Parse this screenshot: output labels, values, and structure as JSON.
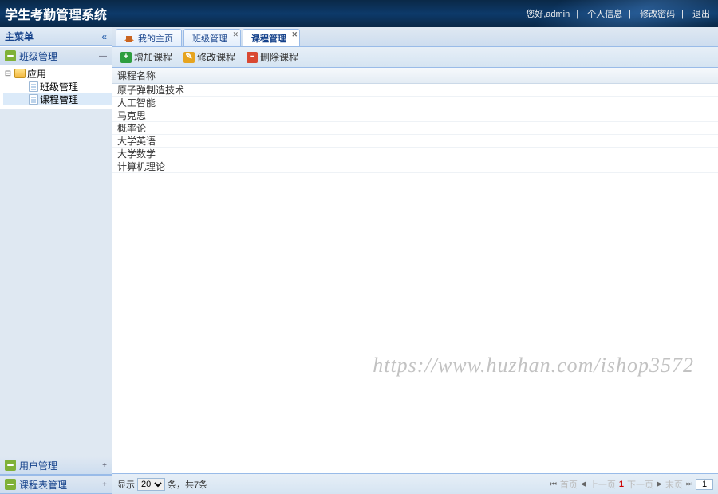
{
  "header": {
    "title": "学生考勤管理系统",
    "greeting": "您好,admin",
    "links": [
      "个人信息",
      "修改密码",
      "退出"
    ]
  },
  "sidebar": {
    "title": "主菜单",
    "panels": [
      {
        "label": "班级管理"
      },
      {
        "label": "用户管理"
      },
      {
        "label": "课程表管理"
      }
    ],
    "tree": {
      "root": {
        "label": "应用"
      },
      "children": [
        {
          "label": "班级管理"
        },
        {
          "label": "课程管理",
          "selected": true
        }
      ]
    }
  },
  "tabs": [
    {
      "label": "我的主页",
      "home": true
    },
    {
      "label": "班级管理",
      "closable": true
    },
    {
      "label": "课程管理",
      "closable": true,
      "active": true
    }
  ],
  "toolbar": {
    "add_label": "增加课程",
    "edit_label": "修改课程",
    "del_label": "删除课程"
  },
  "grid": {
    "header": "课程名称",
    "rows": [
      "原子弹制造技术",
      "人工智能",
      "马克思",
      "概率论",
      "大学英语",
      "大学数学",
      "计算机理论"
    ]
  },
  "status": {
    "show_label": "显示",
    "page_size": "20",
    "unit_label": "条，共7条"
  },
  "pager": {
    "first": "首页",
    "prev": "上一页",
    "current": "1",
    "next": "下一页",
    "last": "末页",
    "page_input": "1"
  },
  "watermark": "https://www.huzhan.com/ishop3572"
}
